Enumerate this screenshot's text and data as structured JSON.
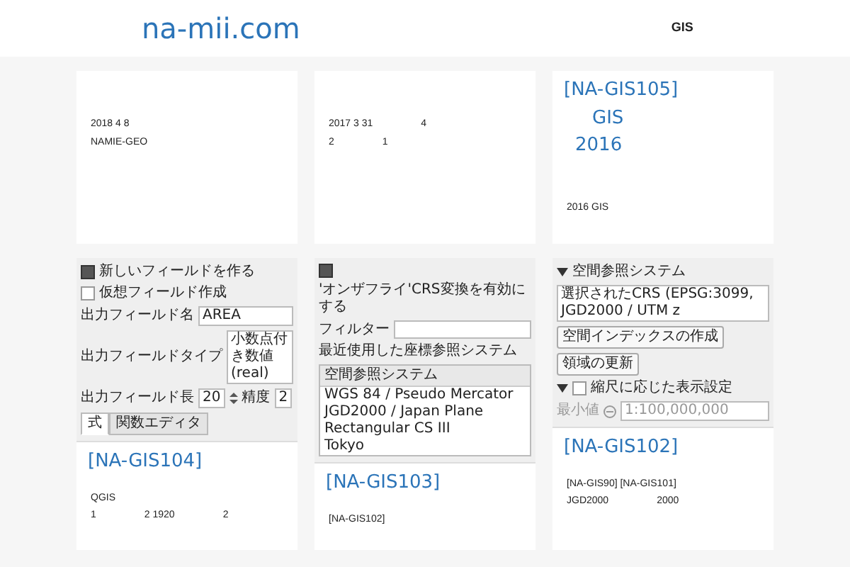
{
  "header": {
    "logo": "na-mii.com",
    "nav": [
      {
        "label": "GIS",
        "selected": false
      }
    ]
  },
  "top_cards": [
    {
      "lines": [
        {
          "parts": [
            "2018 4 8"
          ]
        },
        {
          "parts": [
            "NAMIE-GEO"
          ]
        }
      ]
    },
    {
      "lines": [
        {
          "parts": [
            "2017 3 31",
            "4"
          ]
        },
        {
          "parts": [
            "2",
            "1"
          ]
        }
      ]
    },
    {
      "title_lines": [
        "[NA-GIS105]",
        "GIS",
        "2016"
      ],
      "lines": [
        {
          "parts": [
            "2016  GIS"
          ]
        }
      ]
    }
  ],
  "bottom_cards": [
    {
      "screenshot": {
        "widgets": [
          {
            "kind": "group",
            "label": "新しいフィールドを作る",
            "checked": true
          },
          {
            "kind": "checkbox",
            "label": "仮想フィールド作成",
            "checked": false
          },
          {
            "kind": "field-row",
            "label": "出力フィールド名",
            "value": "AREA"
          },
          {
            "kind": "field-row",
            "label": "出力フィールドタイプ",
            "value": "小数点付き数値(real)"
          },
          {
            "kind": "spin-row",
            "label": "出力フィールド長",
            "value": "20",
            "label2": "精度",
            "value2": "2"
          },
          {
            "kind": "tabs",
            "tabs": [
              {
                "label": "式",
                "selected": true
              },
              {
                "label": "関数エディタ",
                "selected": false
              }
            ]
          }
        ]
      },
      "title": "[NA-GIS104]",
      "lines": [
        {
          "parts": [
            "QGIS"
          ]
        },
        {
          "parts": [
            "1",
            "2 1920",
            "2"
          ]
        }
      ]
    },
    {
      "screenshot": {
        "widgets": [
          {
            "kind": "group",
            "label": "'オンザフライ'CRS変換を有効にする",
            "checked": true
          },
          {
            "kind": "input-row",
            "label": "フィルター"
          },
          {
            "kind": "label",
            "text": "最近使用した座標参照システム"
          },
          {
            "kind": "list",
            "header": "空間参照システム",
            "rows": [
              "WGS 84 / Pseudo Mercator",
              "JGD2000 / Japan Plane Rectangular CS III",
              "Tokyo"
            ]
          }
        ]
      },
      "title": "[NA-GIS103]",
      "lines": [
        {
          "parts": [
            "[NA-GIS102]"
          ]
        }
      ]
    },
    {
      "screenshot": {
        "widgets": [
          {
            "kind": "section",
            "label": "空間参照システム",
            "expanded": true
          },
          {
            "kind": "field",
            "value": "選択されたCRS (EPSG:3099, JGD2000 / UTM z"
          },
          {
            "kind": "buttons",
            "buttons": [
              "空間インデックスの作成",
              "領域の更新"
            ]
          },
          {
            "kind": "section",
            "label": "縮尺に応じた表示設定",
            "expanded": true,
            "checked": false
          },
          {
            "kind": "scale-row",
            "label": "最小値",
            "value": "1:100,000,000",
            "disabled": true
          }
        ]
      },
      "title": "[NA-GIS102]",
      "lines": [
        {
          "parts": [
            "[NA-GIS90] [NA-GIS101]"
          ]
        },
        {
          "parts": [
            "JGD2000",
            "2000"
          ]
        }
      ]
    }
  ]
}
